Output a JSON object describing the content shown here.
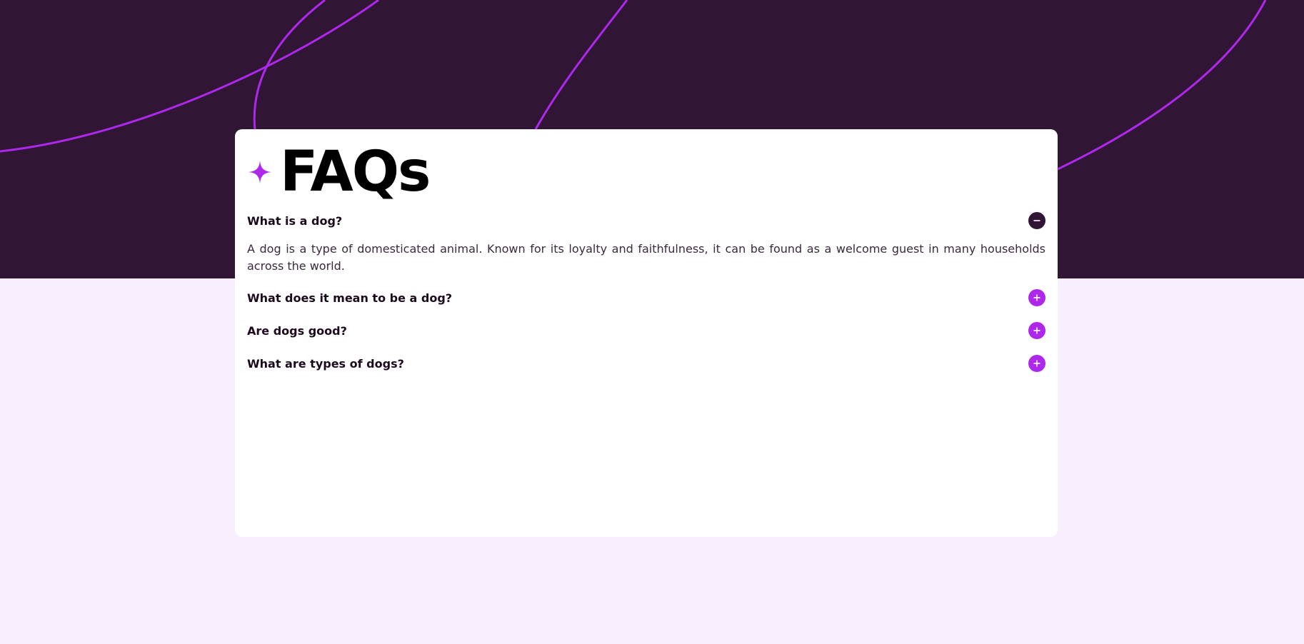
{
  "colors": {
    "hero_bg": "#301534",
    "page_bg": "#f8eefe",
    "accent": "#ad28eb",
    "dark": "#301534"
  },
  "header": {
    "title": "FAQs",
    "icon": "star-icon"
  },
  "faqs": [
    {
      "question": "What is a dog?",
      "answer": "A dog is a type of domesticated animal. Known for its loyalty and faithfulness, it can be found as a welcome guest in many households across the world.",
      "expanded": true,
      "icon": "minus-icon"
    },
    {
      "question": "What does it mean to be a dog?",
      "expanded": false,
      "icon": "plus-icon"
    },
    {
      "question": "Are dogs good?",
      "expanded": false,
      "icon": "plus-icon"
    },
    {
      "question": "What are types of dogs?",
      "expanded": false,
      "icon": "plus-icon"
    }
  ]
}
